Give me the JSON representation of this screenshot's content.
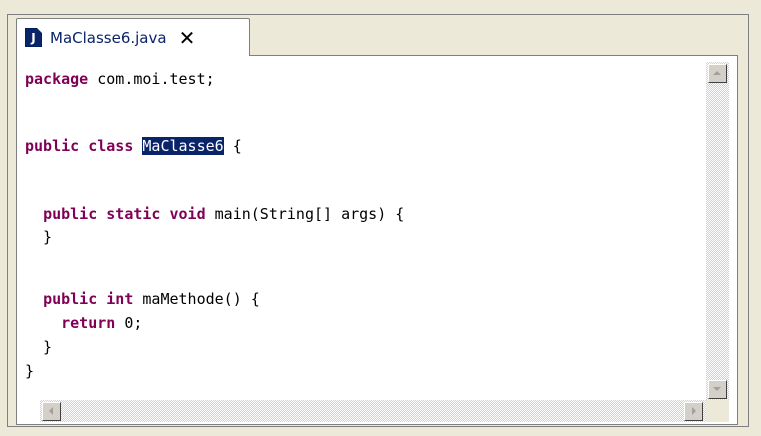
{
  "editor_tab": {
    "filename": "MaClasse6.java",
    "icon": "java-file-icon",
    "icon_glyph": "J",
    "close_glyph": "✕"
  },
  "code": {
    "lines": [
      {
        "parts": [
          {
            "t": "package",
            "k": "kw"
          },
          {
            "t": " com.moi.test;"
          }
        ]
      },
      {
        "parts": []
      },
      {
        "parts": [
          {
            "t": "public",
            "k": "kw"
          },
          {
            "t": " "
          },
          {
            "t": "class",
            "k": "kw"
          },
          {
            "t": " "
          },
          {
            "t": "MaClasse6",
            "k": "sel"
          },
          {
            "t": " {"
          }
        ]
      },
      {
        "parts": []
      },
      {
        "parts": [
          {
            "t": "  "
          },
          {
            "t": "public",
            "k": "kw"
          },
          {
            "t": " "
          },
          {
            "t": "static",
            "k": "kw"
          },
          {
            "t": " "
          },
          {
            "t": "void",
            "k": "kw"
          },
          {
            "t": " main(String[] args) {"
          }
        ]
      },
      {
        "parts": [
          {
            "t": "  }"
          }
        ]
      },
      {
        "parts": []
      },
      {
        "parts": [
          {
            "t": "  "
          },
          {
            "t": "public",
            "k": "kw"
          },
          {
            "t": " "
          },
          {
            "t": "int",
            "k": "kw"
          },
          {
            "t": " maMethode() {"
          }
        ]
      },
      {
        "parts": [
          {
            "t": "    "
          },
          {
            "t": "return",
            "k": "kw"
          },
          {
            "t": " 0;"
          }
        ]
      },
      {
        "parts": [
          {
            "t": "  }"
          }
        ]
      },
      {
        "parts": [
          {
            "t": "}"
          }
        ]
      }
    ],
    "selected_text": "MaClasse6"
  },
  "colors": {
    "keyword": "#7f0055",
    "selection_bg": "#0a246a",
    "selection_fg": "#ffffff",
    "tab_label": "#0a246a"
  }
}
